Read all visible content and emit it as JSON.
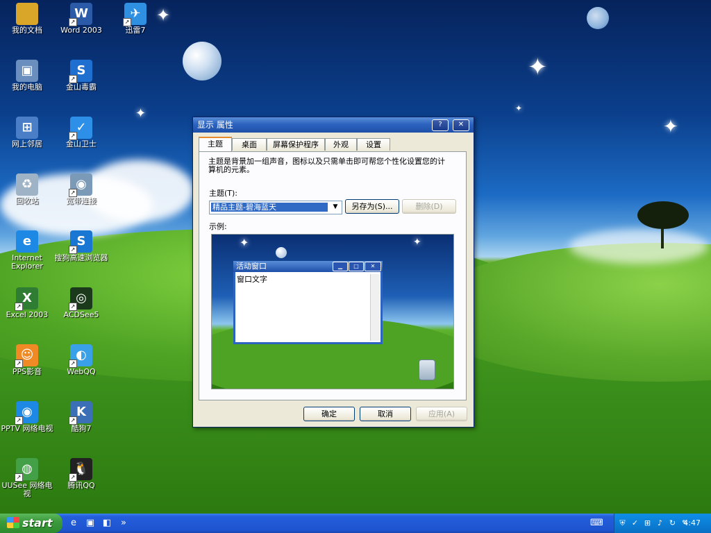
{
  "desktop_icons": [
    {
      "label": "我的文档",
      "icon": "folder-docs-icon",
      "color": "#d9a62a",
      "glyph": "",
      "shortcut": false
    },
    {
      "label": "Word 2003",
      "icon": "word-icon",
      "color": "#2b5ba8",
      "glyph": "W",
      "shortcut": true
    },
    {
      "label": "迅雷7",
      "icon": "thunder-bird-icon",
      "color": "#2f8fe0",
      "glyph": "✈",
      "shortcut": true
    },
    {
      "label": "我的电脑",
      "icon": "my-computer-icon",
      "color": "#6a8fbf",
      "glyph": "▣",
      "shortcut": false
    },
    {
      "label": "金山毒霸",
      "icon": "kingsoft-antivirus-icon",
      "color": "#1f6fd0",
      "glyph": "S",
      "shortcut": true
    },
    {
      "label": "网上邻居",
      "icon": "network-places-icon",
      "color": "#4a7fc8",
      "glyph": "⊞",
      "shortcut": false
    },
    {
      "label": "金山卫士",
      "icon": "kingsoft-guard-icon",
      "color": "#2e8fe8",
      "glyph": "✓",
      "shortcut": true
    },
    {
      "label": "回收站",
      "icon": "recycle-bin-icon",
      "color": "#9fb3c6",
      "glyph": "♻",
      "shortcut": false
    },
    {
      "label": "宽带连接",
      "icon": "broadband-connection-icon",
      "color": "#7a9ab8",
      "glyph": "◉",
      "shortcut": true
    },
    {
      "label": "Internet Explorer",
      "icon": "internet-explorer-icon",
      "color": "#1e88e5",
      "glyph": "e",
      "shortcut": false
    },
    {
      "label": "搜狗高速浏览器",
      "icon": "sogou-browser-icon",
      "color": "#1976d2",
      "glyph": "S",
      "shortcut": true
    },
    {
      "label": "Excel 2003",
      "icon": "excel-icon",
      "color": "#2e7d32",
      "glyph": "X",
      "shortcut": true
    },
    {
      "label": "ACDSee5",
      "icon": "acdsee-eye-icon",
      "color": "#1b3a1b",
      "glyph": "◎",
      "shortcut": true
    },
    {
      "label": "PPS影音",
      "icon": "pps-player-icon",
      "color": "#f08a24",
      "glyph": "☺",
      "shortcut": true
    },
    {
      "label": "WebQQ",
      "icon": "webqq-icon",
      "color": "#3aa0e8",
      "glyph": "◐",
      "shortcut": true
    },
    {
      "label": "PPTV 网络电视",
      "icon": "pptv-icon",
      "color": "#1e88e5",
      "glyph": "◉",
      "shortcut": true
    },
    {
      "label": "酷狗7",
      "icon": "kugou-icon",
      "color": "#3b6fb6",
      "glyph": "K",
      "shortcut": true
    },
    {
      "label": "UUSee 网络电视",
      "icon": "uusee-icon",
      "color": "#43a047",
      "glyph": "◍",
      "shortcut": true
    },
    {
      "label": "腾讯QQ",
      "icon": "qq-penguin-icon",
      "color": "#222222",
      "glyph": "🐧",
      "shortcut": true
    }
  ],
  "dialog": {
    "title": "显示 属性",
    "help_btn": "?",
    "close_btn": "✕",
    "tabs": [
      "主题",
      "桌面",
      "屏幕保护程序",
      "外观",
      "设置"
    ],
    "description": "主题是背景加一组声音，图标以及只需单击即可帮您个性化设置您的计算机的元素。",
    "theme_label": "主题(T):",
    "theme_value": "精品主题-碧海蓝天",
    "save_as_btn": "另存为(S)...",
    "delete_btn": "删除(D)",
    "sample_label": "示例:",
    "preview": {
      "window_title": "活动窗口",
      "window_text": "窗口文字"
    },
    "ok_btn": "确定",
    "cancel_btn": "取消",
    "apply_btn": "应用(A)"
  },
  "taskbar": {
    "start_label": "start",
    "quick_launch": [
      "ie-icon",
      "show-desktop-icon",
      "explorer-icon"
    ],
    "chevron": "»",
    "tray_icons": [
      "keyboard-icon",
      "shield-icon",
      "guard-icon",
      "network-icon",
      "sound-icon",
      "update-icon",
      "wrench-icon"
    ],
    "clock": "4:47"
  },
  "colors": {
    "titlebar": "#2d64c0",
    "tab_accent": "#e68b2c",
    "selection": "#316ac5",
    "taskbar": "#245edb",
    "start": "#3c9b3c"
  }
}
